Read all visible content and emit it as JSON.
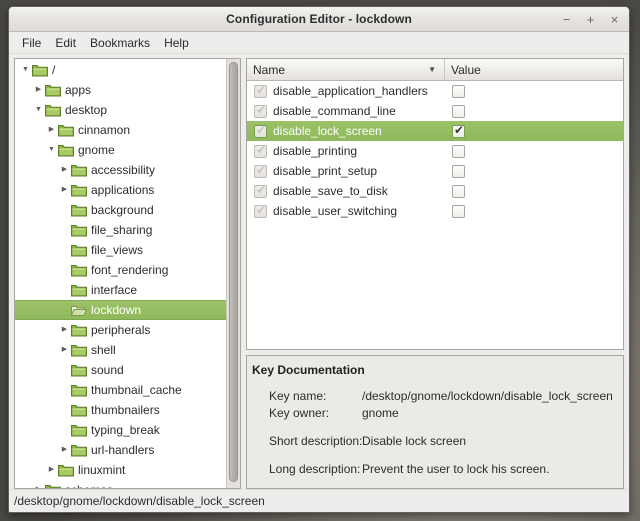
{
  "window": {
    "title": "Configuration Editor - lockdown",
    "controls": [
      {
        "name": "minimize",
        "glyph": "−"
      },
      {
        "name": "maximize",
        "glyph": "+"
      },
      {
        "name": "close",
        "glyph": "×"
      }
    ]
  },
  "menubar": {
    "items": [
      "File",
      "Edit",
      "Bookmarks",
      "Help"
    ]
  },
  "colors": {
    "selection": "#93bd5f",
    "folder_icon": "#7fb03c",
    "window_bg": "#ededeb",
    "list_bg": "#ffffff"
  },
  "tree": {
    "nodes": [
      {
        "label": "/",
        "depth": 0,
        "expander": "expanded",
        "selected": false,
        "icon": "folder-icon"
      },
      {
        "label": "apps",
        "depth": 1,
        "expander": "collapsed",
        "selected": false,
        "icon": "folder-icon"
      },
      {
        "label": "desktop",
        "depth": 1,
        "expander": "expanded",
        "selected": false,
        "icon": "folder-icon"
      },
      {
        "label": "cinnamon",
        "depth": 2,
        "expander": "collapsed",
        "selected": false,
        "icon": "folder-icon"
      },
      {
        "label": "gnome",
        "depth": 2,
        "expander": "expanded",
        "selected": false,
        "icon": "folder-icon"
      },
      {
        "label": "accessibility",
        "depth": 3,
        "expander": "collapsed",
        "selected": false,
        "icon": "folder-icon"
      },
      {
        "label": "applications",
        "depth": 3,
        "expander": "collapsed",
        "selected": false,
        "icon": "folder-icon"
      },
      {
        "label": "background",
        "depth": 3,
        "expander": "none",
        "selected": false,
        "icon": "folder-icon"
      },
      {
        "label": "file_sharing",
        "depth": 3,
        "expander": "none",
        "selected": false,
        "icon": "folder-icon"
      },
      {
        "label": "file_views",
        "depth": 3,
        "expander": "none",
        "selected": false,
        "icon": "folder-icon"
      },
      {
        "label": "font_rendering",
        "depth": 3,
        "expander": "none",
        "selected": false,
        "icon": "folder-icon"
      },
      {
        "label": "interface",
        "depth": 3,
        "expander": "none",
        "selected": false,
        "icon": "folder-icon"
      },
      {
        "label": "lockdown",
        "depth": 3,
        "expander": "none",
        "selected": true,
        "icon": "folder-open-icon"
      },
      {
        "label": "peripherals",
        "depth": 3,
        "expander": "collapsed",
        "selected": false,
        "icon": "folder-icon"
      },
      {
        "label": "shell",
        "depth": 3,
        "expander": "collapsed",
        "selected": false,
        "icon": "folder-icon"
      },
      {
        "label": "sound",
        "depth": 3,
        "expander": "none",
        "selected": false,
        "icon": "folder-icon"
      },
      {
        "label": "thumbnail_cache",
        "depth": 3,
        "expander": "none",
        "selected": false,
        "icon": "folder-icon"
      },
      {
        "label": "thumbnailers",
        "depth": 3,
        "expander": "none",
        "selected": false,
        "icon": "folder-icon"
      },
      {
        "label": "typing_break",
        "depth": 3,
        "expander": "none",
        "selected": false,
        "icon": "folder-icon"
      },
      {
        "label": "url-handlers",
        "depth": 3,
        "expander": "collapsed",
        "selected": false,
        "icon": "folder-icon"
      },
      {
        "label": "linuxmint",
        "depth": 2,
        "expander": "collapsed",
        "selected": false,
        "icon": "folder-icon"
      },
      {
        "label": "schemas",
        "depth": 1,
        "expander": "collapsed",
        "selected": false,
        "icon": "folder-icon"
      }
    ]
  },
  "list": {
    "columns": [
      {
        "label": "Name",
        "sort": "descending"
      },
      {
        "label": "Value",
        "sort": "none"
      }
    ],
    "rows": [
      {
        "name": "disable_application_handlers",
        "name_checked": true,
        "value_checked": false,
        "selected": false
      },
      {
        "name": "disable_command_line",
        "name_checked": true,
        "value_checked": false,
        "selected": false
      },
      {
        "name": "disable_lock_screen",
        "name_checked": true,
        "value_checked": true,
        "selected": true
      },
      {
        "name": "disable_printing",
        "name_checked": true,
        "value_checked": false,
        "selected": false
      },
      {
        "name": "disable_print_setup",
        "name_checked": true,
        "value_checked": false,
        "selected": false
      },
      {
        "name": "disable_save_to_disk",
        "name_checked": true,
        "value_checked": false,
        "selected": false
      },
      {
        "name": "disable_user_switching",
        "name_checked": true,
        "value_checked": false,
        "selected": false
      }
    ]
  },
  "documentation": {
    "title": "Key Documentation",
    "key_name_label": "Key name:",
    "key_name_value": "/desktop/gnome/lockdown/disable_lock_screen",
    "key_owner_label": "Key owner:",
    "key_owner_value": "gnome",
    "short_desc_label": "Short description:",
    "short_desc_value": "Disable lock screen",
    "long_desc_label": "Long description:",
    "long_desc_value": "Prevent the user to lock his screen."
  },
  "statusbar": {
    "path": "/desktop/gnome/lockdown/disable_lock_screen"
  }
}
